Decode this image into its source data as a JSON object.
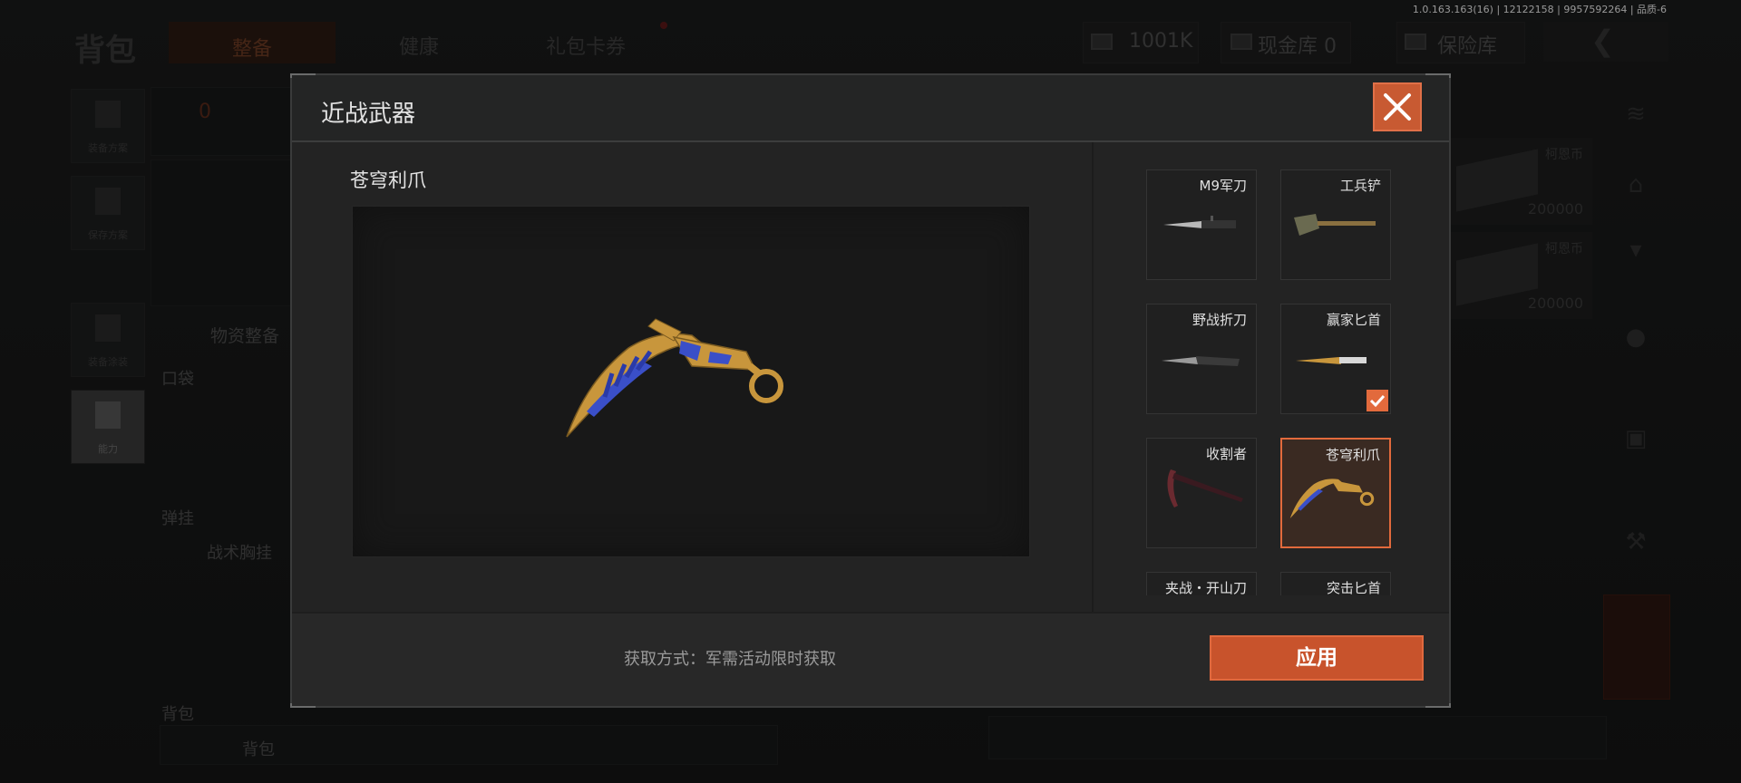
{
  "version_info": "1.0.163.163(16) | 12122158 | 9957592264 | 品质-6",
  "background": {
    "title": "背包",
    "tabs": [
      "整备",
      "健康",
      "礼包卡券"
    ],
    "currency": {
      "cash": "1001K",
      "vault_label": "现金库 0",
      "insurance_label": "保险库"
    },
    "left_buttons": [
      "装备方案",
      "保存方案",
      "装备涂装",
      "能力"
    ],
    "armor_count": "0",
    "supplies_label": "物资整备",
    "pocket_label": "口袋",
    "rig_label": "弹挂",
    "rig_item": "战术胸挂",
    "backpack_label": "背包",
    "backpack_item": "背包",
    "right_items": [
      {
        "name": "柯恩币",
        "amount": "200000"
      },
      {
        "name": "柯恩币",
        "amount": "200000"
      }
    ]
  },
  "modal": {
    "title": "近战武器",
    "preview_name": "苍穹利爪",
    "weapons": [
      {
        "name": "M9军刀",
        "icon": "bayonet-icon",
        "selected": false,
        "equipped": false
      },
      {
        "name": "工兵铲",
        "icon": "shovel-icon",
        "selected": false,
        "equipped": false
      },
      {
        "name": "野战折刀",
        "icon": "folding-knife-icon",
        "selected": false,
        "equipped": false
      },
      {
        "name": "赢家匕首",
        "icon": "dagger-icon",
        "selected": false,
        "equipped": true
      },
      {
        "name": "收割者",
        "icon": "sickle-icon",
        "selected": false,
        "equipped": false
      },
      {
        "name": "苍穹利爪",
        "icon": "karambit-icon",
        "selected": true,
        "equipped": false
      },
      {
        "name": "夹战・开山刀",
        "icon": "machete-icon",
        "selected": false,
        "equipped": false
      },
      {
        "name": "突击匕首",
        "icon": "knife-icon",
        "selected": false,
        "equipped": false
      }
    ],
    "acquire_text": "获取方式：军需活动限时获取",
    "apply_label": "应用",
    "colors": {
      "accent": "#e26a3c",
      "button": "#c8532c",
      "gold": "#c8963c",
      "blue": "#3a4fc8"
    }
  }
}
